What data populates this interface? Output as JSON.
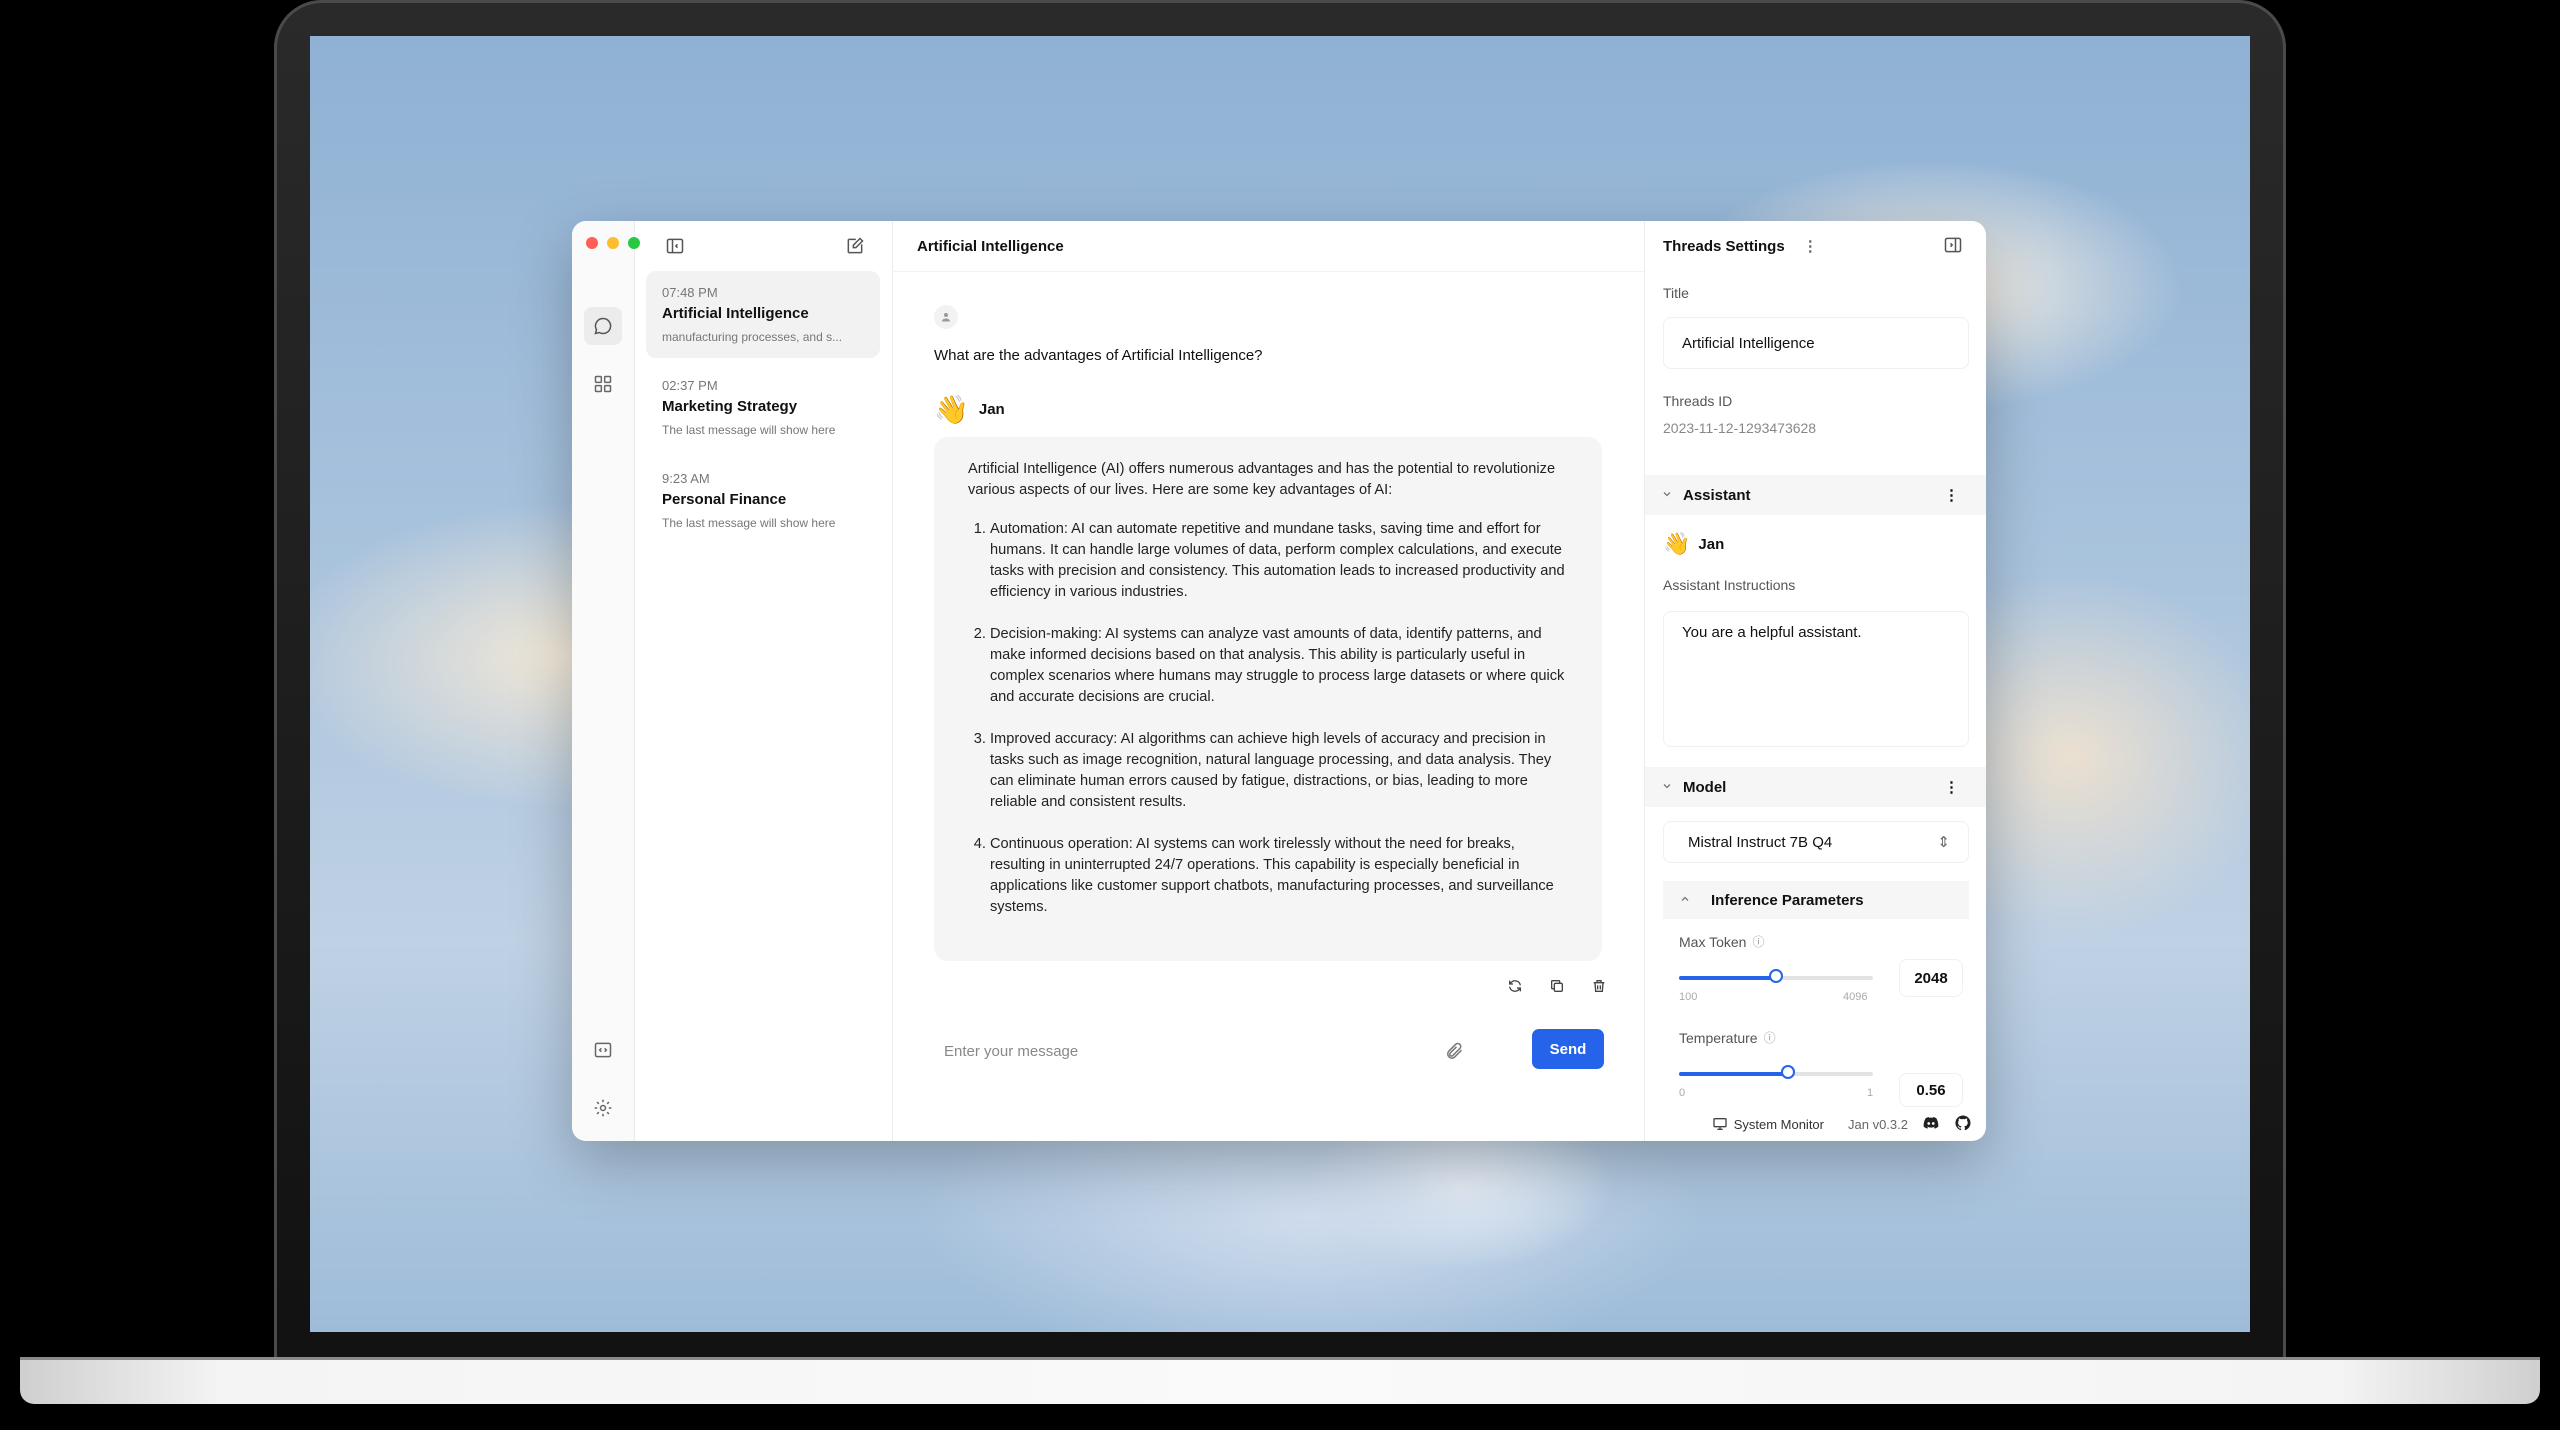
{
  "window": {
    "controls": [
      "close",
      "minimize",
      "maximize"
    ]
  },
  "rail": {
    "icons": [
      "chat-bubble-icon",
      "grid-icon",
      "code-icon",
      "settings-gear-icon"
    ]
  },
  "thread_list": {
    "items": [
      {
        "time": "07:48 PM",
        "title": "Artificial Intelligence",
        "preview": "manufacturing processes, and s...",
        "active": true
      },
      {
        "time": "02:37 PM",
        "title": "Marketing Strategy",
        "preview": "The last message will show here"
      },
      {
        "time": "9:23 AM",
        "title": "Personal Finance",
        "preview": "The last message will show here"
      }
    ]
  },
  "chat": {
    "title": "Artificial Intelligence",
    "user_question": "What are the advantages of Artificial Intelligence?",
    "assistant_name": "Jan",
    "assistant_emoji": "👋",
    "answer_intro": "Artificial Intelligence (AI) offers numerous advantages and has the potential to revolutionize various aspects of our lives. Here are some key advantages of AI:",
    "answer_points": [
      "Automation: AI can automate repetitive and mundane tasks, saving time and effort for humans. It can handle large volumes of data, perform complex calculations, and execute tasks with precision and consistency. This automation leads to increased productivity and efficiency in various industries.",
      "Decision-making: AI systems can analyze vast amounts of data, identify patterns, and make informed decisions based on that analysis. This ability is particularly useful in complex scenarios where humans may struggle to process large datasets or where quick and accurate decisions are crucial.",
      "Improved accuracy: AI algorithms can achieve high levels of accuracy and precision in tasks such as image recognition, natural language processing, and data analysis. They can eliminate human errors caused by fatigue, distractions, or bias, leading to more reliable and consistent results.",
      "Continuous operation: AI systems can work tirelessly without the need for breaks, resulting in uninterrupted 24/7 operations. This capability is especially beneficial in applications like customer support chatbots, manufacturing processes, and surveillance systems."
    ],
    "composer_placeholder": "Enter your message",
    "send_label": "Send"
  },
  "settings": {
    "header": "Threads Settings",
    "title_label": "Title",
    "title_value": "Artificial Intelligence",
    "thread_id_label": "Threads ID",
    "thread_id_value": "2023-11-12-1293473628",
    "assistant_section": "Assistant",
    "assistant_name": "Jan",
    "instructions_label": "Assistant Instructions",
    "instructions_value": "You are a helpful assistant.",
    "model_section": "Model",
    "model_value": "Mistral Instruct 7B Q4",
    "inference_section": "Inference Parameters",
    "max_token_label": "Max Token",
    "max_token_min": "100",
    "max_token_max": "4096",
    "max_token_value": "2048",
    "max_token_fraction": 0.5,
    "temperature_label": "Temperature",
    "temperature_min": "0",
    "temperature_max": "1",
    "temperature_value": "0.56",
    "temperature_fraction": 0.56
  },
  "footer": {
    "system_monitor": "System Monitor",
    "version": "Jan v0.3.2",
    "icons": [
      "discord-icon",
      "github-icon"
    ]
  },
  "colors": {
    "accent": "#2563eb",
    "close": "#ff5f57",
    "minimize": "#febc2e",
    "maximize": "#28c840"
  }
}
